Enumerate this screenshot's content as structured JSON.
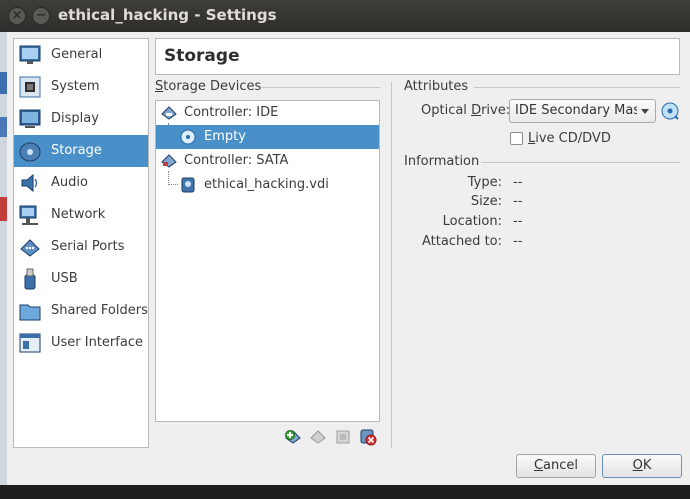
{
  "window": {
    "title": "ethical_hacking - Settings"
  },
  "sidebar": {
    "items": [
      {
        "label": "General",
        "icon": "general-icon",
        "selected": false
      },
      {
        "label": "System",
        "icon": "system-icon",
        "selected": false
      },
      {
        "label": "Display",
        "icon": "display-icon",
        "selected": false
      },
      {
        "label": "Storage",
        "icon": "storage-icon",
        "selected": true
      },
      {
        "label": "Audio",
        "icon": "audio-icon",
        "selected": false
      },
      {
        "label": "Network",
        "icon": "network-icon",
        "selected": false
      },
      {
        "label": "Serial Ports",
        "icon": "serial-ports-icon",
        "selected": false
      },
      {
        "label": "USB",
        "icon": "usb-icon",
        "selected": false
      },
      {
        "label": "Shared Folders",
        "icon": "shared-folders-icon",
        "selected": false
      },
      {
        "label": "User Interface",
        "icon": "user-interface-icon",
        "selected": false
      }
    ]
  },
  "page": {
    "title": "Storage"
  },
  "storage_devices": {
    "label": "Storage Devices",
    "tree": [
      {
        "label": "Controller: IDE",
        "kind": "controller"
      },
      {
        "label": "Empty",
        "kind": "optical",
        "selected": true
      },
      {
        "label": "Controller: SATA",
        "kind": "controller"
      },
      {
        "label": "ethical_hacking.vdi",
        "kind": "disk"
      }
    ],
    "toolbar": [
      "add-controller-icon",
      "add-attachment-icon",
      "remove-attachment-icon",
      "remove-controller-icon"
    ]
  },
  "attributes": {
    "label": "Attributes",
    "optical_drive_label": "Optical Drive:",
    "optical_drive_value": "IDE Secondary Mast",
    "live_cd_label": "Live CD/DVD",
    "live_cd_checked": false
  },
  "information": {
    "label": "Information",
    "rows": [
      {
        "key": "Type:",
        "value": "--"
      },
      {
        "key": "Size:",
        "value": "--"
      },
      {
        "key": "Location:",
        "value": "--"
      },
      {
        "key": "Attached to:",
        "value": "--"
      }
    ]
  },
  "buttons": {
    "cancel": "Cancel",
    "ok": "OK"
  },
  "colors": {
    "selection": "#4a90c8",
    "titlebar": "#3e3d39"
  }
}
